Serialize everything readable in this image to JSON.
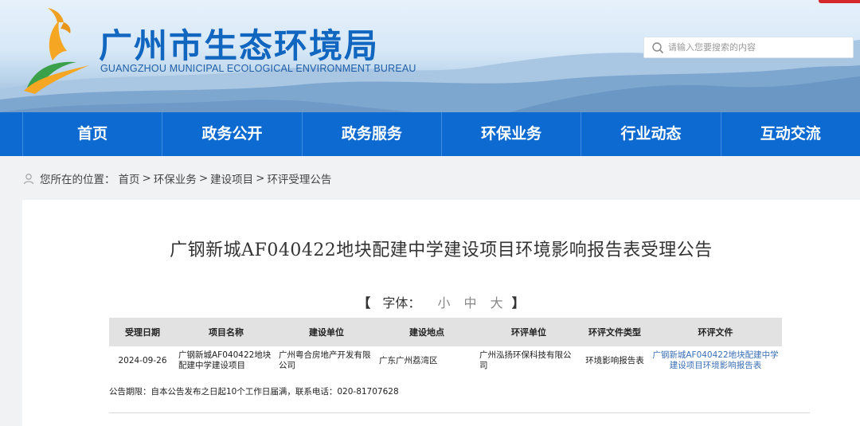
{
  "header": {
    "title": "广州市生态环境局",
    "subtitle": "GUANGZHOU MUNICIPAL ECOLOGICAL ENVIRONMENT BUREAU",
    "search_placeholder": "请输入您要搜索的内容"
  },
  "nav": {
    "items": [
      {
        "label": "首页"
      },
      {
        "label": "政务公开"
      },
      {
        "label": "政务服务"
      },
      {
        "label": "环保业务"
      },
      {
        "label": "行业动态"
      },
      {
        "label": "互动交流"
      }
    ]
  },
  "breadcrumb": {
    "prefix": "您所在的位置：",
    "items": [
      "首页",
      "环保业务",
      "建设项目",
      "环评受理公告"
    ],
    "separator": ">"
  },
  "article": {
    "title": "广钢新城AF040422地块配建中学建设项目环境影响报告表受理公告",
    "font_size_label": "字体：",
    "font_size_options": [
      "小",
      "中",
      "大"
    ],
    "bracket_left": "【",
    "bracket_right": "】",
    "table": {
      "headers": [
        "受理日期",
        "项目名称",
        "建设单位",
        "建设地点",
        "环评单位",
        "环评文件类型",
        "环评文件"
      ],
      "rows": [
        [
          "2024-09-26",
          "广钢新城AF040422地块配建中学建设项目",
          "广州粤合房地产开发有限公司",
          "广东广州荔湾区",
          "广州泓扬环保科技有限公司",
          "环境影响报告表",
          "广钢新城AF040422地块配建中学建设项目环境影响报告表"
        ]
      ]
    },
    "footnote": "公告期限：自本公告发布之日起10个工作日届满，联系电话：020-81707628"
  },
  "colors": {
    "nav_bg": "#0d6ad0",
    "title_blue": "#1166c0",
    "link": "#3a6fb7",
    "accent_red": "#d4282a"
  }
}
